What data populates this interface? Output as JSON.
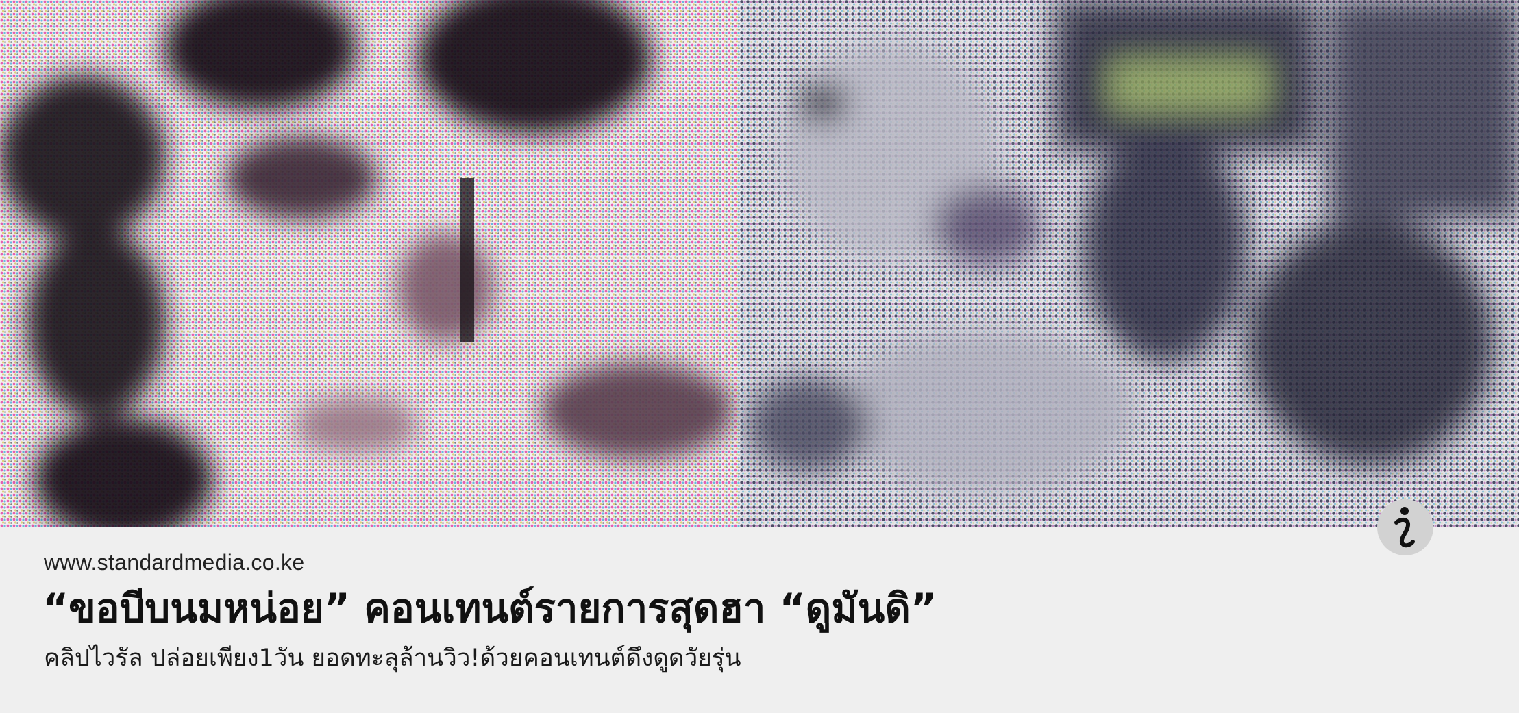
{
  "caption": {
    "source": "www.standardmedia.co.ke",
    "headline": "“ขอบีบนมหน่อย” คอนเทนต์รายการสุดฮา “ดูมันดิ”",
    "subheadline": "คลิปไวรัล ปล่อยเพียง1วัน ยอดทะลุล้านวิว!ด้วยคอนเทนต์ดึงดูดวัยรุ่น"
  },
  "icons": {
    "info": "info-icon"
  },
  "colors": {
    "caption_background": "#efefef",
    "text": "#111111",
    "info_badge": "#d2d2d2"
  }
}
